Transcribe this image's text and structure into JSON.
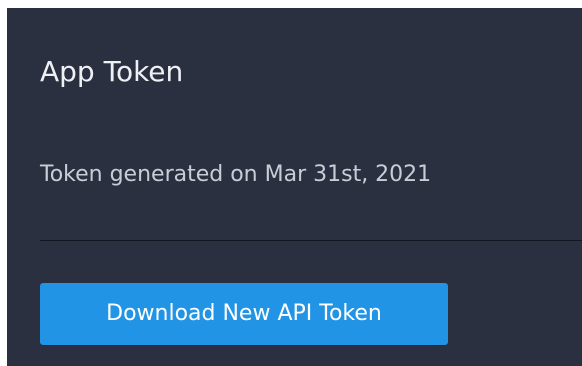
{
  "panel": {
    "title": "App Token",
    "token_info": "Token generated on Mar 31st, 2021",
    "download_button_label": "Download New API Token"
  },
  "colors": {
    "panel_background": "#2a3040",
    "button_accent": "#2194e5"
  }
}
